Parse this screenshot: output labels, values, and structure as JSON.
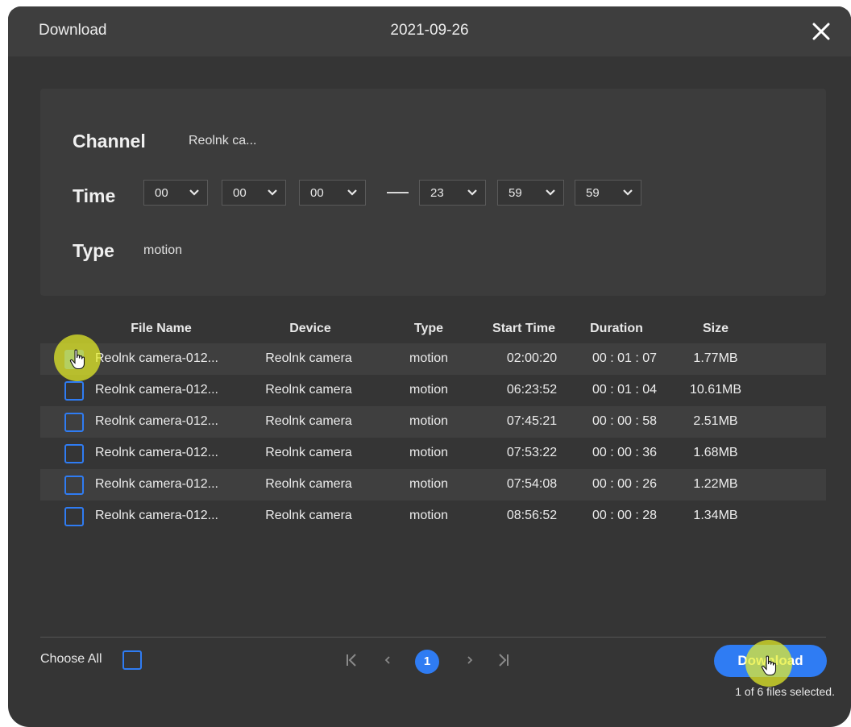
{
  "dialog": {
    "title": "Download",
    "date": "2021-09-26"
  },
  "filters": {
    "channel_label": "Channel",
    "channel_value": "Reolnk ca...",
    "time_label": "Time",
    "start": {
      "hh": "00",
      "mm": "00",
      "ss": "00"
    },
    "end": {
      "hh": "23",
      "mm": "59",
      "ss": "59"
    },
    "type_label": "Type",
    "type_value": "motion"
  },
  "table": {
    "headers": [
      "File Name",
      "Device",
      "Type",
      "Start Time",
      "Duration",
      "Size"
    ],
    "rows": [
      {
        "file": "Reolnk camera-012...",
        "device": "Reolnk camera",
        "type": "motion",
        "start": "02:00:20",
        "duration": "00 : 01 : 07",
        "size": "1.77MB",
        "checked": true
      },
      {
        "file": "Reolnk camera-012...",
        "device": "Reolnk camera",
        "type": "motion",
        "start": "06:23:52",
        "duration": "00 : 01 : 04",
        "size": "10.61MB",
        "checked": false
      },
      {
        "file": "Reolnk camera-012...",
        "device": "Reolnk camera",
        "type": "motion",
        "start": "07:45:21",
        "duration": "00 : 00 : 58",
        "size": "2.51MB",
        "checked": false
      },
      {
        "file": "Reolnk camera-012...",
        "device": "Reolnk camera",
        "type": "motion",
        "start": "07:53:22",
        "duration": "00 : 00 : 36",
        "size": "1.68MB",
        "checked": false
      },
      {
        "file": "Reolnk camera-012...",
        "device": "Reolnk camera",
        "type": "motion",
        "start": "07:54:08",
        "duration": "00 : 00 : 26",
        "size": "1.22MB",
        "checked": false
      },
      {
        "file": "Reolnk camera-012...",
        "device": "Reolnk camera",
        "type": "motion",
        "start": "08:56:52",
        "duration": "00 : 00 : 28",
        "size": "1.34MB",
        "checked": false
      }
    ]
  },
  "footer": {
    "choose_all_label": "Choose All",
    "current_page": "1",
    "download_label": "Download",
    "selection_status": "1 of 6 files selected."
  },
  "icons": {
    "close": "close-icon",
    "chevron": "chevron-down-icon",
    "first_page": "first-page-icon",
    "prev_page": "prev-page-icon",
    "next_page": "next-page-icon",
    "last_page": "last-page-icon",
    "cursor": "hand-cursor-icon"
  },
  "colors": {
    "accent": "#2f7cf3",
    "dialog_bg": "#353535",
    "highlight": "#e8f028"
  }
}
